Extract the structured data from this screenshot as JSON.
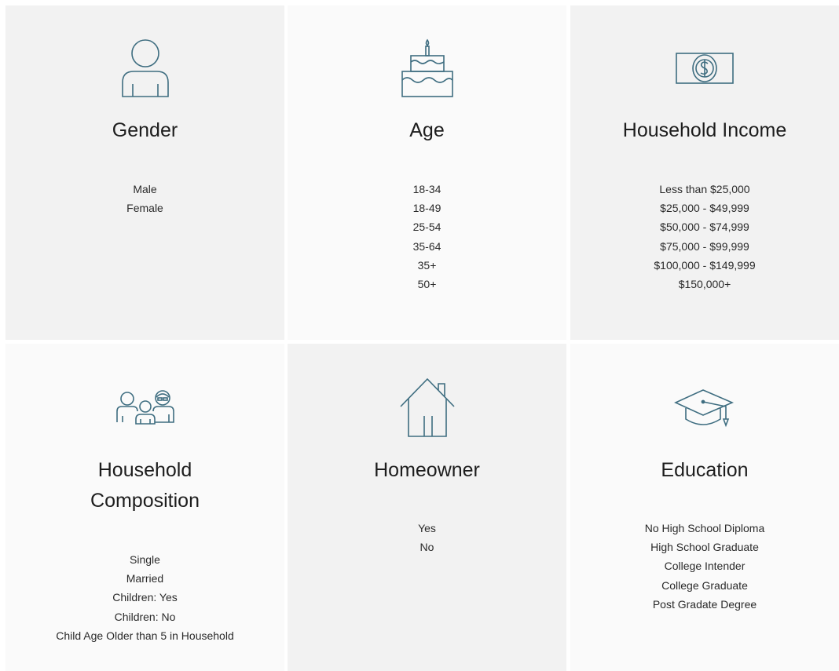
{
  "colors": {
    "icon_stroke": "#3e6d80",
    "card_dark": "#f2f2f2",
    "card_light": "#fafafa",
    "text": "#1f1f1f"
  },
  "cards": [
    {
      "icon": "person-icon",
      "title": "Gender",
      "options": [
        "Male",
        "Female"
      ]
    },
    {
      "icon": "birthday-cake-icon",
      "title": "Age",
      "options": [
        "18-34",
        "18-49",
        "25-54",
        "35-64",
        "35+",
        "50+"
      ]
    },
    {
      "icon": "dollar-bill-icon",
      "title": "Household Income",
      "options": [
        "Less than $25,000",
        "$25,000 - $49,999",
        "$50,000 - $74,999",
        "$75,000 - $99,999",
        "$100,000 - $149,999",
        "$150,000+"
      ]
    },
    {
      "icon": "family-icon",
      "title_line1": "Household",
      "title_line2": "Composition",
      "options": [
        "Single",
        "Married",
        "Children: Yes",
        "Children: No",
        "Child Age Older than 5 in Household"
      ]
    },
    {
      "icon": "house-icon",
      "title": "Homeowner",
      "options": [
        "Yes",
        "No"
      ]
    },
    {
      "icon": "graduation-cap-icon",
      "title": "Education",
      "options": [
        "No High School Diploma",
        "High School Graduate",
        "College Intender",
        "College Graduate",
        "Post Gradate Degree"
      ]
    }
  ]
}
